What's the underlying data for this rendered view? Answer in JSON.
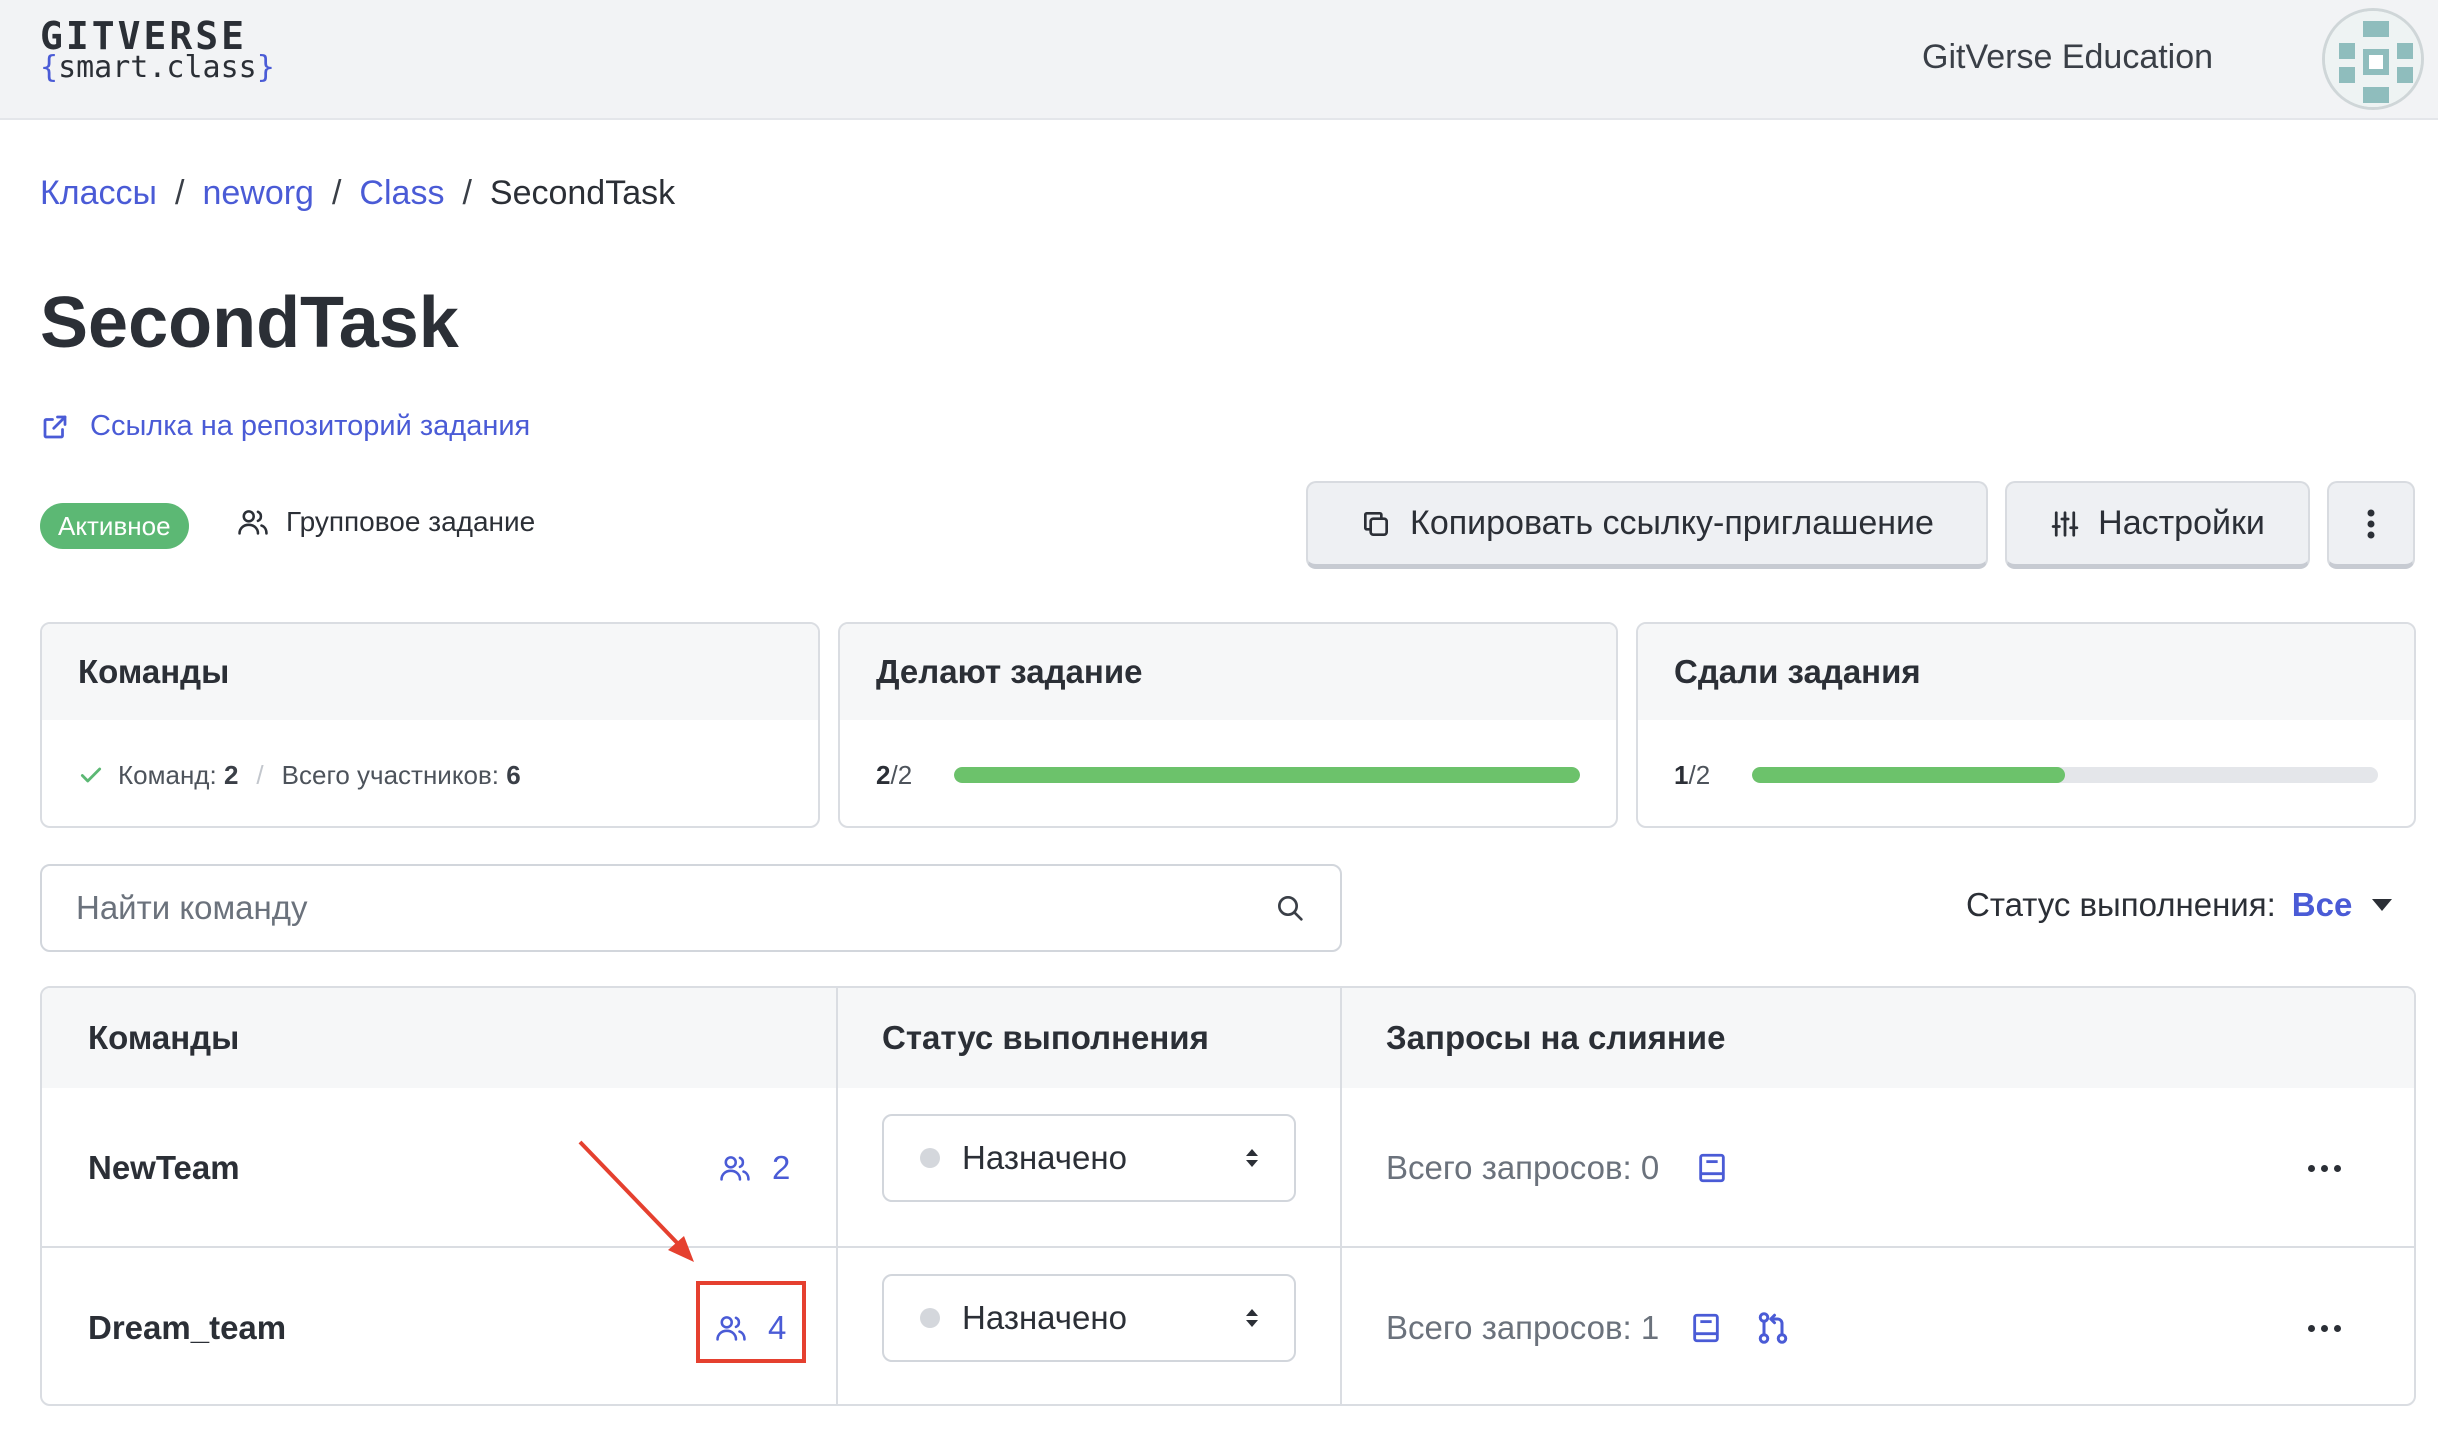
{
  "header": {
    "logo_top": "GITVERSE",
    "logo_brace_open": "{",
    "logo_bottom": "smart.class",
    "logo_brace_close": "}",
    "org_name": "GitVerse Education",
    "avatar_icon": "avatar-pattern-icon"
  },
  "breadcrumb": {
    "items": [
      "Классы",
      "neworg",
      "Class"
    ],
    "separator": "/",
    "current": "SecondTask"
  },
  "task": {
    "title": "SecondTask",
    "repo_link": "Ссылка на репозиторий задания",
    "status_badge": "Активное",
    "type": "Групповое задание"
  },
  "actions": {
    "copy_invite": "Копировать ссылку-приглашение",
    "settings": "Настройки"
  },
  "stats": {
    "teams": {
      "title": "Команды",
      "teams_label": "Команд:",
      "teams_count": "2",
      "members_label": "Всего участников:",
      "members_count": "6"
    },
    "doing": {
      "title": "Делают задание",
      "done": "2",
      "total": "/2",
      "fraction": 1.0
    },
    "submitted": {
      "title": "Сдали задания",
      "done": "1",
      "total": "/2",
      "fraction": 0.5
    }
  },
  "search": {
    "placeholder": "Найти команду"
  },
  "filter": {
    "label": "Статус выполнения:",
    "value": "Все"
  },
  "table": {
    "columns": [
      "Команды",
      "Статус выполнения",
      "Запросы на слияние"
    ],
    "rows": [
      {
        "name": "NewTeam",
        "members": "2",
        "status": "Назначено",
        "requests": "Всего запросов: 0"
      },
      {
        "name": "Dream_team",
        "members": "4",
        "status": "Назначено",
        "requests": "Всего запросов: 1"
      }
    ]
  },
  "colors": {
    "accent": "#4a5bd6",
    "success": "#5cb874",
    "progress": "#6cc26b",
    "annotation": "#e5402f"
  }
}
